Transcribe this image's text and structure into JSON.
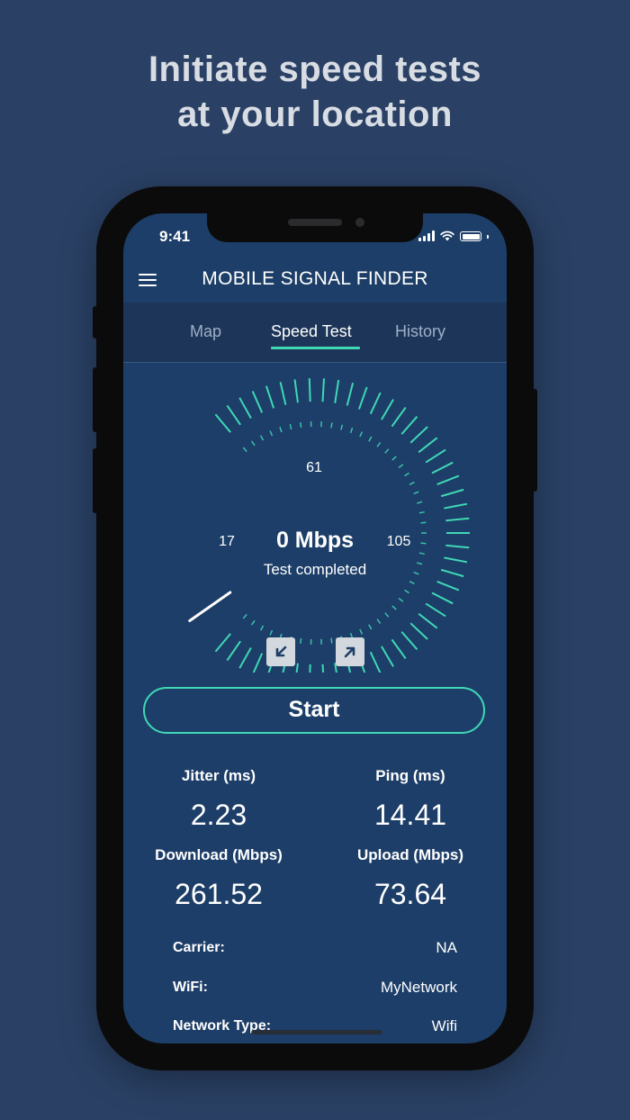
{
  "headline": {
    "line1": "Initiate speed tests",
    "line2": "at your location"
  },
  "status_bar": {
    "time": "9:41"
  },
  "app": {
    "title": "MOBILE SIGNAL FINDER"
  },
  "tabs": [
    {
      "label": "Map",
      "active": false
    },
    {
      "label": "Speed Test",
      "active": true
    },
    {
      "label": "History",
      "active": false
    }
  ],
  "gauge": {
    "speed": "0 Mbps",
    "status": "Test completed",
    "scale_left": "17",
    "scale_top": "61",
    "scale_right": "105",
    "needle_value": 0
  },
  "start_button": {
    "label": "Start"
  },
  "stats": {
    "jitter": {
      "label": "Jitter (ms)",
      "value": "2.23"
    },
    "ping": {
      "label": "Ping (ms)",
      "value": "14.41"
    },
    "download": {
      "label": "Download (Mbps)",
      "value": "261.52"
    },
    "upload": {
      "label": "Upload (Mbps)",
      "value": "73.64"
    }
  },
  "info": {
    "carrier": {
      "label": "Carrier:",
      "value": "NA"
    },
    "wifi": {
      "label": "WiFi:",
      "value": "MyNetwork"
    },
    "network_type": {
      "label": "Network Type:",
      "value": "Wifi"
    }
  },
  "colors": {
    "background": "#2a4165",
    "screen": "#1d3e68",
    "accent": "#3fd8b5",
    "tab_bar": "#1c3558"
  },
  "icons": {
    "menu": "menu-icon",
    "download_arrow": "arrow-down-left-icon",
    "upload_arrow": "arrow-up-right-icon"
  }
}
